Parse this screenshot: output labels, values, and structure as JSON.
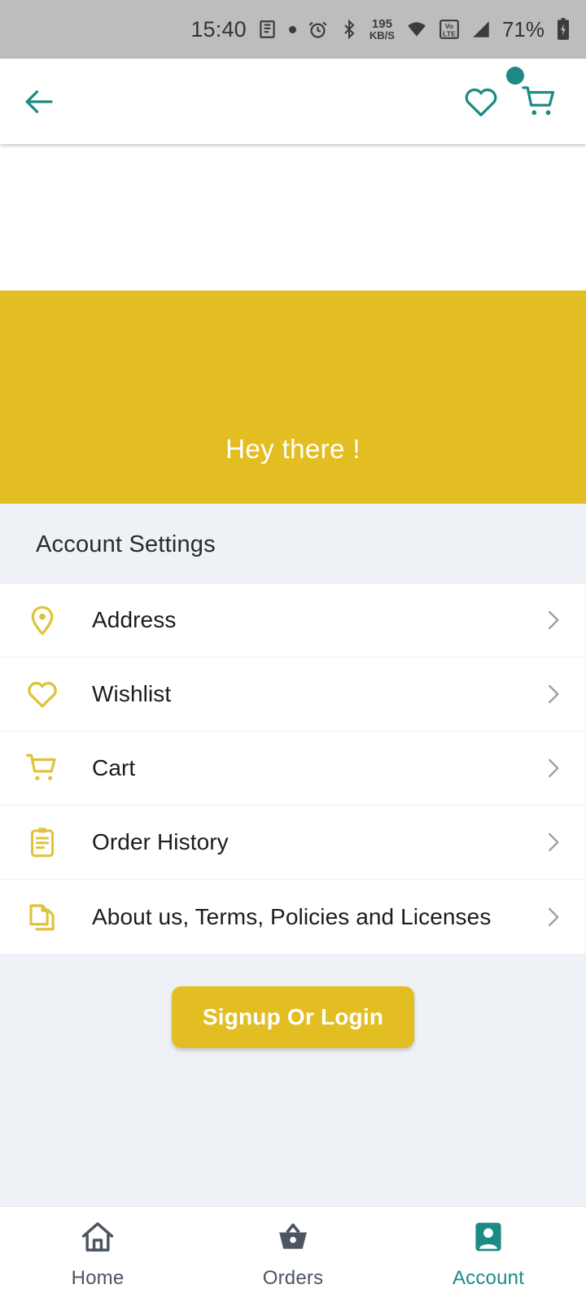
{
  "status_bar": {
    "time": "15:40",
    "network_speed_value": "195",
    "network_speed_unit": "KB/S",
    "battery_percent": "71%",
    "icons": [
      "notes-icon",
      "dot-icon",
      "alarm-icon",
      "bluetooth-icon",
      "wifi-icon",
      "volte-icon",
      "signal-icon",
      "battery-charging-icon"
    ],
    "background": "#bdbdbd"
  },
  "app_bar": {
    "back_label": "Back",
    "wishlist_label": "Wishlist",
    "cart_label": "Cart",
    "cart_has_badge": true,
    "accent": "#1d8a86"
  },
  "banner": {
    "greeting": "Hey there !",
    "background": "#e3be22",
    "text_color": "#ffffff"
  },
  "settings": {
    "section_title": "Account Settings",
    "items": [
      {
        "label": "Address",
        "icon": "location-pin-icon"
      },
      {
        "label": "Wishlist",
        "icon": "heart-icon"
      },
      {
        "label": "Cart",
        "icon": "shopping-cart-icon"
      },
      {
        "label": "Order History",
        "icon": "clipboard-icon"
      },
      {
        "label": "About us, Terms, Policies and Licenses",
        "icon": "documents-icon"
      }
    ],
    "icon_color": "#e0c23a",
    "chevron_color": "#9aa0a6"
  },
  "cta": {
    "label": "Signup Or Login",
    "background": "#e3be22",
    "text_color": "#ffffff"
  },
  "bottom_nav": {
    "active_color": "#1d8a86",
    "inactive_color": "#4b5563",
    "items": [
      {
        "label": "Home",
        "icon": "home-icon",
        "active": false
      },
      {
        "label": "Orders",
        "icon": "basket-icon",
        "active": false
      },
      {
        "label": "Account",
        "icon": "account-icon",
        "active": true
      }
    ]
  }
}
